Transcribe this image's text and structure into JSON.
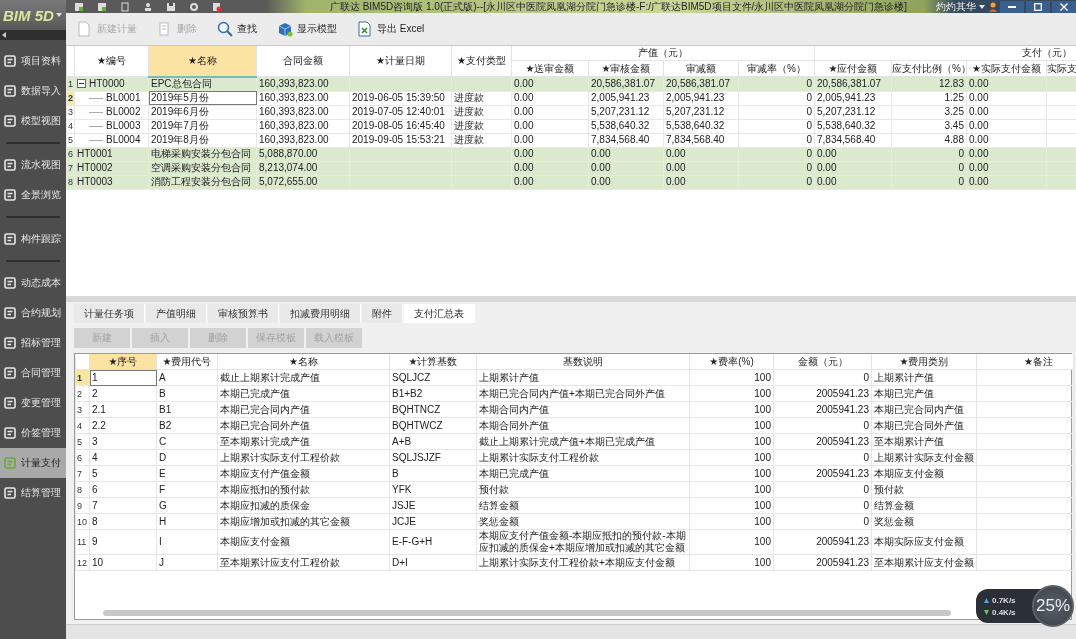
{
  "window": {
    "title": "广联达 BIM5D咨询版 1.0(正式版)--[永川区中医院凤凰湖分院门急诊楼-F:/广联达BIM5D项目文件/永川区中医院凤凰湖分院门急诊楼]",
    "user": "灼灼其华"
  },
  "sidebar": {
    "logo": "BIM 5D",
    "groups": [
      {
        "items": [
          {
            "label": "项目资料",
            "selected": false
          },
          {
            "label": "数据导入",
            "selected": false
          },
          {
            "label": "模型视图",
            "selected": false
          }
        ]
      },
      {
        "items": [
          {
            "label": "流水视图",
            "selected": false
          },
          {
            "label": "全景浏览",
            "selected": false
          }
        ]
      },
      {
        "items": [
          {
            "label": "构件跟踪",
            "selected": false
          }
        ]
      },
      {
        "items": [
          {
            "label": "动态成本",
            "selected": false
          },
          {
            "label": "合约规划",
            "selected": false
          },
          {
            "label": "招标管理",
            "selected": false
          },
          {
            "label": "合同管理",
            "selected": false
          },
          {
            "label": "变更管理",
            "selected": false
          },
          {
            "label": "价签管理",
            "selected": false
          },
          {
            "label": "计量支付",
            "selected": true
          },
          {
            "label": "结算管理",
            "selected": false
          }
        ]
      }
    ]
  },
  "toolbar": [
    {
      "label": "新建计量",
      "kind": "new",
      "disabled": true
    },
    {
      "label": "删除",
      "kind": "delete",
      "disabled": true
    },
    {
      "label": "查找",
      "kind": "search",
      "disabled": false
    },
    {
      "label": "显示模型",
      "kind": "model",
      "disabled": false
    },
    {
      "label": "导出 Excel",
      "kind": "export",
      "disabled": false
    }
  ],
  "contracts_table": {
    "columns": [
      {
        "label": "★编号",
        "selected": false
      },
      {
        "label": "★名称",
        "selected": true
      },
      {
        "label": "合同金额",
        "selected": false
      },
      {
        "label": "★计量日期",
        "selected": false
      },
      {
        "label": "★支付类型",
        "selected": false
      },
      {
        "label": "产值（元）",
        "children": [
          {
            "label": "★送审金额",
            "selected": false
          },
          {
            "label": "★审核金额",
            "selected": false
          },
          {
            "label": "审减额",
            "selected": false
          },
          {
            "label": "审减率（%）",
            "selected": false
          }
        ]
      },
      {
        "label": "支付（元）",
        "children": [
          {
            "label": "★应付金额",
            "selected": false
          },
          {
            "label": "应支付比例（%）",
            "selected": false
          },
          {
            "label": "★实际支付金额",
            "selected": false
          },
          {
            "label": "实际支",
            "selected": false
          }
        ]
      }
    ],
    "rows": [
      {
        "number": "1",
        "kind": "contract",
        "expanded": true,
        "selected": false,
        "code": "HT0000",
        "name": "EPC总包合同",
        "amount": "160,393,823.00",
        "submitted": "0.00",
        "approved": "20,586,381.07",
        "reduction": "20,586,381.07",
        "reduction_rate": "0",
        "payable": "20,586,381.07",
        "pay_ratio": "12.83",
        "paid": "0.00",
        "children": [
          {
            "number": "2",
            "kind": "period",
            "selected": true,
            "code": "BL0001",
            "name": "2019年5月份",
            "amount": "160,393,823.00",
            "date": "2019-06-05 15:39:50",
            "pay_type": "进度款",
            "submitted": "0.00",
            "approved": "2,005,941.23",
            "reduction": "2,005,941.23",
            "reduction_rate": "0",
            "payable": "2,005,941.23",
            "pay_ratio": "1.25",
            "paid": "0.00"
          },
          {
            "number": "3",
            "kind": "period",
            "selected": false,
            "code": "BL0002",
            "name": "2019年6月份",
            "amount": "160,393,823.00",
            "date": "2019-07-05 12:40:01",
            "pay_type": "进度款",
            "submitted": "0.00",
            "approved": "5,207,231.12",
            "reduction": "5,207,231.12",
            "reduction_rate": "0",
            "payable": "5,207,231.12",
            "pay_ratio": "3.25",
            "paid": "0.00"
          },
          {
            "number": "4",
            "kind": "period",
            "selected": false,
            "code": "BL0003",
            "name": "2019年7月份",
            "amount": "160,393,823.00",
            "date": "2019-08-05 16:45:40",
            "pay_type": "进度款",
            "submitted": "0.00",
            "approved": "5,538,640.32",
            "reduction": "5,538,640.32",
            "reduction_rate": "0",
            "payable": "5,538,640.32",
            "pay_ratio": "3.45",
            "paid": "0.00"
          },
          {
            "number": "5",
            "kind": "period",
            "selected": false,
            "code": "BL0004",
            "name": "2019年8月份",
            "amount": "160,393,823.00",
            "date": "2019-09-05 15:53:21",
            "pay_type": "进度款",
            "submitted": "0.00",
            "approved": "7,834,568.40",
            "reduction": "7,834,568.40",
            "reduction_rate": "0",
            "payable": "7,834,568.40",
            "pay_ratio": "4.88",
            "paid": "0.00"
          }
        ]
      },
      {
        "number": "6",
        "kind": "contract",
        "selected": false,
        "code": "HT0001",
        "name": "电梯采购安装分包合同",
        "amount": "5,088,870.00",
        "submitted": "0.00",
        "approved": "0.00",
        "reduction": "0.00",
        "reduction_rate": "0",
        "payable": "0.00",
        "pay_ratio": "0",
        "paid": "0.00"
      },
      {
        "number": "7",
        "kind": "contract",
        "selected": false,
        "code": "HT0002",
        "name": "空调采购安装分包合同",
        "amount": "8,213,074.00",
        "submitted": "0.00",
        "approved": "0.00",
        "reduction": "0.00",
        "reduction_rate": "0",
        "payable": "0.00",
        "pay_ratio": "0",
        "paid": "0.00"
      },
      {
        "number": "8",
        "kind": "contract",
        "selected": false,
        "code": "HT0003",
        "name": "消防工程安装分包合同",
        "amount": "5,072,655.00",
        "submitted": "0.00",
        "approved": "0.00",
        "reduction": "0.00",
        "reduction_rate": "0",
        "payable": "0.00",
        "pay_ratio": "0",
        "paid": "0.00"
      }
    ]
  },
  "tabs": [
    {
      "label": "计量任务项",
      "selected": false
    },
    {
      "label": "产值明细",
      "selected": false
    },
    {
      "label": "审核预算书",
      "selected": false
    },
    {
      "label": "扣减费用明细",
      "selected": false
    },
    {
      "label": "附件",
      "selected": false
    },
    {
      "label": "支付汇总表",
      "selected": true
    }
  ],
  "grid_buttons": [
    {
      "label": "新建",
      "disabled": true
    },
    {
      "label": "插入",
      "disabled": true
    },
    {
      "label": "删除",
      "disabled": true
    },
    {
      "label": "保存模板",
      "disabled": true
    },
    {
      "label": "载入模板",
      "disabled": true
    }
  ],
  "payment_table": {
    "columns": [
      {
        "label": "★序号",
        "selected": true
      },
      {
        "label": "★费用代号",
        "selected": false
      },
      {
        "label": "★名称",
        "selected": false
      },
      {
        "label": "★计算基数",
        "selected": false
      },
      {
        "label": "基数说明",
        "selected": false
      },
      {
        "label": "★费率(%)",
        "selected": false
      },
      {
        "label": "金额（元）",
        "selected": false
      },
      {
        "label": "★费用类别",
        "selected": false
      },
      {
        "label": "★备注",
        "selected": false
      }
    ],
    "rows": [
      {
        "number": "1",
        "selected": true,
        "seq": "1",
        "code": "A",
        "name": "截止上期累计完成产值",
        "base": "SQLJCZ",
        "base_desc": "上期累计产值",
        "rate": "100",
        "amount": "0",
        "category": "上期累计产值"
      },
      {
        "number": "2",
        "selected": false,
        "seq": "2",
        "code": "B",
        "name": "本期已完成产值",
        "base": "B1+B2",
        "base_desc": "本期已完合同内产值+本期已完合同外产值",
        "rate": "100",
        "amount": "2005941.23",
        "category": "本期已完产值"
      },
      {
        "number": "3",
        "selected": false,
        "seq": "2.1",
        "code": "B1",
        "name": "本期已完合同内产值",
        "base": "BQHTNCZ",
        "base_desc": "本期合同内产值",
        "rate": "100",
        "amount": "2005941.23",
        "category": "本期已完合同内产值"
      },
      {
        "number": "4",
        "selected": false,
        "seq": "2.2",
        "code": "B2",
        "name": "本期已完合同外产值",
        "base": "BQHTWCZ",
        "base_desc": "本期合同外产值",
        "rate": "100",
        "amount": "0",
        "category": "本期已完合同外产值"
      },
      {
        "number": "5",
        "selected": false,
        "seq": "3",
        "code": "C",
        "name": "至本期累计完成产值",
        "base": "A+B",
        "base_desc": "截止上期累计完成产值+本期已完成产值",
        "rate": "100",
        "amount": "2005941.23",
        "category": "至本期累计产值"
      },
      {
        "number": "6",
        "selected": false,
        "seq": "4",
        "code": "D",
        "name": "上期累计实际支付工程价款",
        "base": "SQLJSJZF",
        "base_desc": "上期累计实际支付工程价款",
        "rate": "100",
        "amount": "0",
        "category": "上期累计实际支付金额"
      },
      {
        "number": "7",
        "selected": false,
        "seq": "5",
        "code": "E",
        "name": "本期应支付产值金额",
        "base": "B",
        "base_desc": "本期已完成产值",
        "rate": "100",
        "amount": "2005941.23",
        "category": "本期应支付金额"
      },
      {
        "number": "8",
        "selected": false,
        "seq": "6",
        "code": "F",
        "name": "本期应抵扣的预付款",
        "base": "YFK",
        "base_desc": "预付款",
        "rate": "100",
        "amount": "0",
        "category": "预付款"
      },
      {
        "number": "9",
        "selected": false,
        "seq": "7",
        "code": "G",
        "name": "本期应扣减的质保金",
        "base": "JSJE",
        "base_desc": "结算金额",
        "rate": "100",
        "amount": "0",
        "category": "结算金额"
      },
      {
        "number": "10",
        "selected": false,
        "seq": "8",
        "code": "H",
        "name": "本期应增加或扣减的其它金额",
        "base": "JCJE",
        "base_desc": "奖惩金额",
        "rate": "100",
        "amount": "0",
        "category": "奖惩金额"
      },
      {
        "number": "11",
        "selected": false,
        "seq": "9",
        "code": "I",
        "name": "本期应支付金额",
        "base": "E-F-G+H",
        "base_desc": "本期应支付产值金额-本期应抵扣的预付款-本期应扣减的质保金+本期应增加或扣减的其它金额",
        "rate": "100",
        "amount": "2005941.23",
        "category": "本期实际应支付金额"
      },
      {
        "number": "12",
        "selected": false,
        "seq": "10",
        "code": "J",
        "name": "至本期累计应支付工程价款",
        "base": "D+I",
        "base_desc": "上期累计实际支付工程价款+本期应支付金额",
        "rate": "100",
        "amount": "2005941.23",
        "category": "至本期累计应支付金额"
      }
    ]
  },
  "net_monitor": {
    "upload": "0.7K/s",
    "download": "0.4K/s",
    "usage": "25%"
  }
}
